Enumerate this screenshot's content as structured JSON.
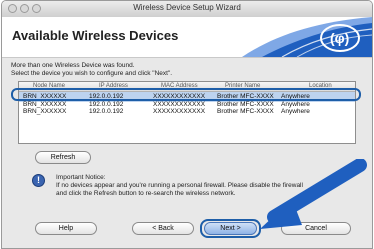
{
  "window": {
    "title": "Wireless Device Setup Wizard"
  },
  "header": {
    "title": "Available Wireless Devices"
  },
  "instructions": {
    "line1": "More than one Wireless Device was found.",
    "line2": "Select the device you wish to configure and click \"Next\"."
  },
  "table": {
    "columns": [
      "Node Name",
      "IP Address",
      "MAC Address",
      "Printer Name",
      "Location"
    ],
    "rows": [
      {
        "node": "BRN_XXXXXX",
        "ip": "192.0.0.192",
        "mac": "XXXXXXXXXXXX",
        "printer": "Brother MFC-XXXX",
        "location": "Anywhere",
        "selected": true
      },
      {
        "node": "BRN_XXXXXX",
        "ip": "192.0.0.192",
        "mac": "XXXXXXXXXXXX",
        "printer": "Brother MFC-XXXX",
        "location": "Anywhere",
        "selected": false
      },
      {
        "node": "BRN_XXXXXX",
        "ip": "192.0.0.192",
        "mac": "XXXXXXXXXXXX",
        "printer": "Brother MFC-XXXX",
        "location": "Anywhere",
        "selected": false
      }
    ]
  },
  "buttons": {
    "refresh": "Refresh",
    "help": "Help",
    "back": "< Back",
    "next": "Next >",
    "cancel": "Cancel"
  },
  "notice": {
    "title": "Important Notice:",
    "line1": "If no devices appear and you're running a personal firewall. Please disable the firewall",
    "line2": "and click the Refresh button to re-search the wireless network."
  },
  "icons": {
    "notice": "info-icon",
    "logo": "wireless-logo-icon",
    "callout": "arrow-icon"
  },
  "colors": {
    "highlight": "#1e5ea8",
    "selection": "#bdd3ef",
    "header_wave": "#1f5fbf"
  }
}
